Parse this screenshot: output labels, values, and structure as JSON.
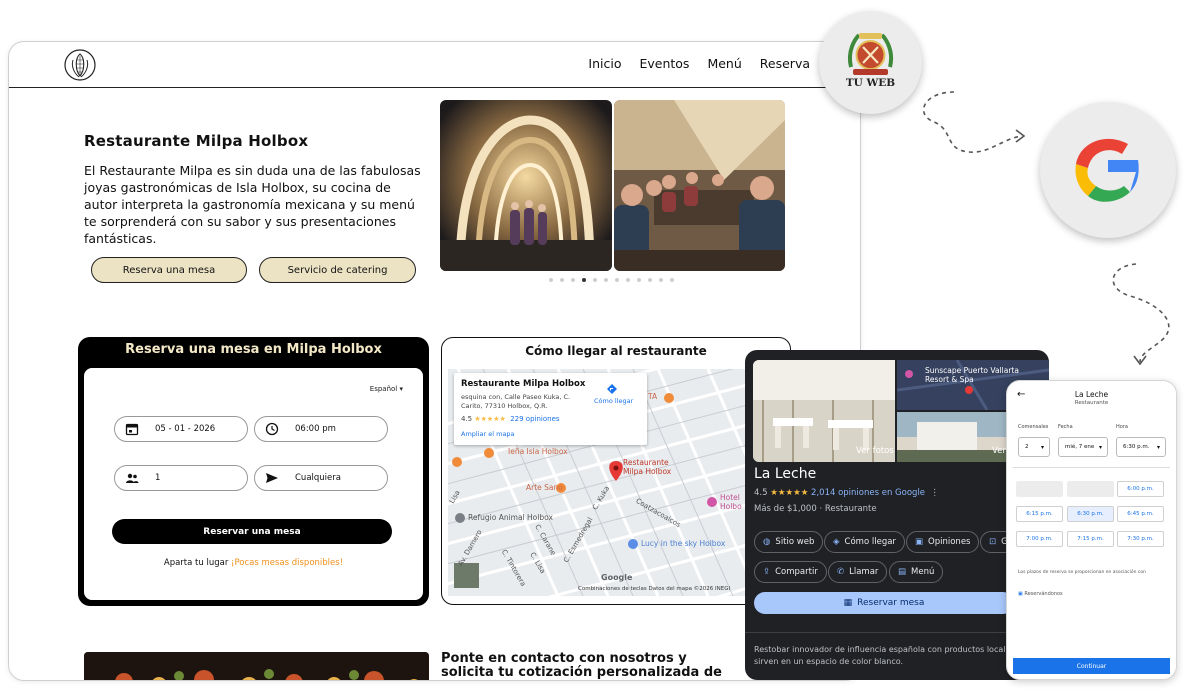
{
  "site": {
    "nav": [
      "Inicio",
      "Eventos",
      "Menú",
      "Reserva"
    ],
    "hero": {
      "title": "Restaurante Milpa Holbox",
      "text": "El Restaurante Milpa es sin duda una de las fabulosas joyas gastronómicas de Isla Holbox, su cocina de autor interpreta la gastronomía mexicana y su menú te sorprenderá con su sabor y sus presentaciones fantásticas.",
      "btn_reserva": "Reserva una mesa",
      "btn_catering": "Servicio de catering"
    },
    "carousel": {
      "count": 12,
      "active_index": 3
    },
    "reservation": {
      "title": "Reserva una mesa en Milpa Holbox",
      "language": "Español",
      "date": "05 - 01 - 2026",
      "time": "06:00 pm",
      "people": "1",
      "zone": "Cualquiera",
      "submit": "Reservar una mesa",
      "note_prefix": "Aparta tu lugar",
      "note_highlight": "¡Pocas mesas disponibles!"
    },
    "map": {
      "title": "Cómo llegar al restaurante",
      "place_name": "Restaurante Milpa Holbox",
      "address": "esquina con, Calle Paseo Kuka, C. Carito, 77310 Holbox, Q.R.",
      "rating": "4.5",
      "reviews": "229 opiniones",
      "directions": "Cómo llegar",
      "enlarge": "Ampliar el mapa",
      "labels": {
        "pin": "Restaurante Milpa Holbox",
        "l1": "Ieña Isla Holbox",
        "l2": "Arte Sano",
        "l3": "Refugio Animal Holbox",
        "l4": "Lucy in the sky Holbox",
        "l5": "Hotel Holbo",
        "l6": "TA",
        "s1": "C. Kuka",
        "s2": "Coatzacoalcos",
        "s3": "C. Esmedregal",
        "s4": "C. Carane",
        "s5": "C. Tintorera",
        "s6": "C. Lisa",
        "s7": "Av. Damero",
        "s8": "Lisa"
      },
      "footer": "Combinaciones de teclas   Datos del mapa ©2026 INEGI"
    },
    "contact_title": "Ponte en contacto con nosotros y solicita tu cotización personalizada de catering"
  },
  "badges": {
    "tuweb": "TU WEB"
  },
  "google_panel": {
    "name": "La Leche",
    "rating": "4.5",
    "stars": "★★★★★",
    "reviews": "2,014 opiniones en Google",
    "price_type": "Más de $1,000 · Restaurante",
    "photos_label": "Ver fotos",
    "photos_label2": "Ver po",
    "map_label": "Sunscape Puerto Vallarta Resort & Spa",
    "chips": [
      "Sitio web",
      "Cómo llegar",
      "Opiniones",
      "G",
      "Compartir",
      "Llamar",
      "Menú"
    ],
    "reserve": "Reservar mesa",
    "description": "Restobar innovador de influencia española con productos locales que se sirven en un espacio de color blanco."
  },
  "phone": {
    "title": "La Leche",
    "subtitle": "Restaurante",
    "labels": [
      "Comensales",
      "Fecha",
      "Hora"
    ],
    "values": [
      "2",
      "mié, 7 ene",
      "6:30 p.m."
    ],
    "slots": [
      "",
      "",
      "6:00 p.m.",
      "6:15 p.m.",
      "6:30 p.m.",
      "6:45 p.m.",
      "7:00 p.m.",
      "7:15 p.m.",
      "7:30 p.m."
    ],
    "selected_slot": "6:30 p.m.",
    "note": "Los plazos de reserva se proporcionan en asociación con",
    "partner": "Reservándonos",
    "continue": "Continuar"
  }
}
